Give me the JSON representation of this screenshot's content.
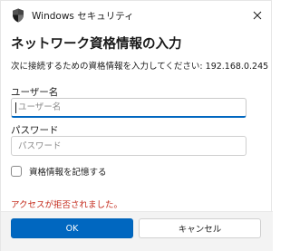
{
  "window": {
    "title": "Windows セキュリティ",
    "icon": "shield-icon",
    "close_icon": "close-icon"
  },
  "dialog": {
    "heading": "ネットワーク資格情報の入力",
    "description": "次に接続するための資格情報を入力してください: 192.168.0.245",
    "username": {
      "label": "ユーザー名",
      "placeholder": "ユーザー名",
      "value": ""
    },
    "password": {
      "label": "パスワード",
      "placeholder": "パスワード",
      "value": ""
    },
    "remember": {
      "label": "資格情報を記憶する",
      "checked": false
    },
    "error_message": "アクセスが拒否されました。"
  },
  "buttons": {
    "ok_label": "OK",
    "cancel_label": "キャンセル"
  },
  "colors": {
    "accent": "#0067c0",
    "error": "#c42b1c",
    "footer_bg": "#f3f3f3"
  }
}
